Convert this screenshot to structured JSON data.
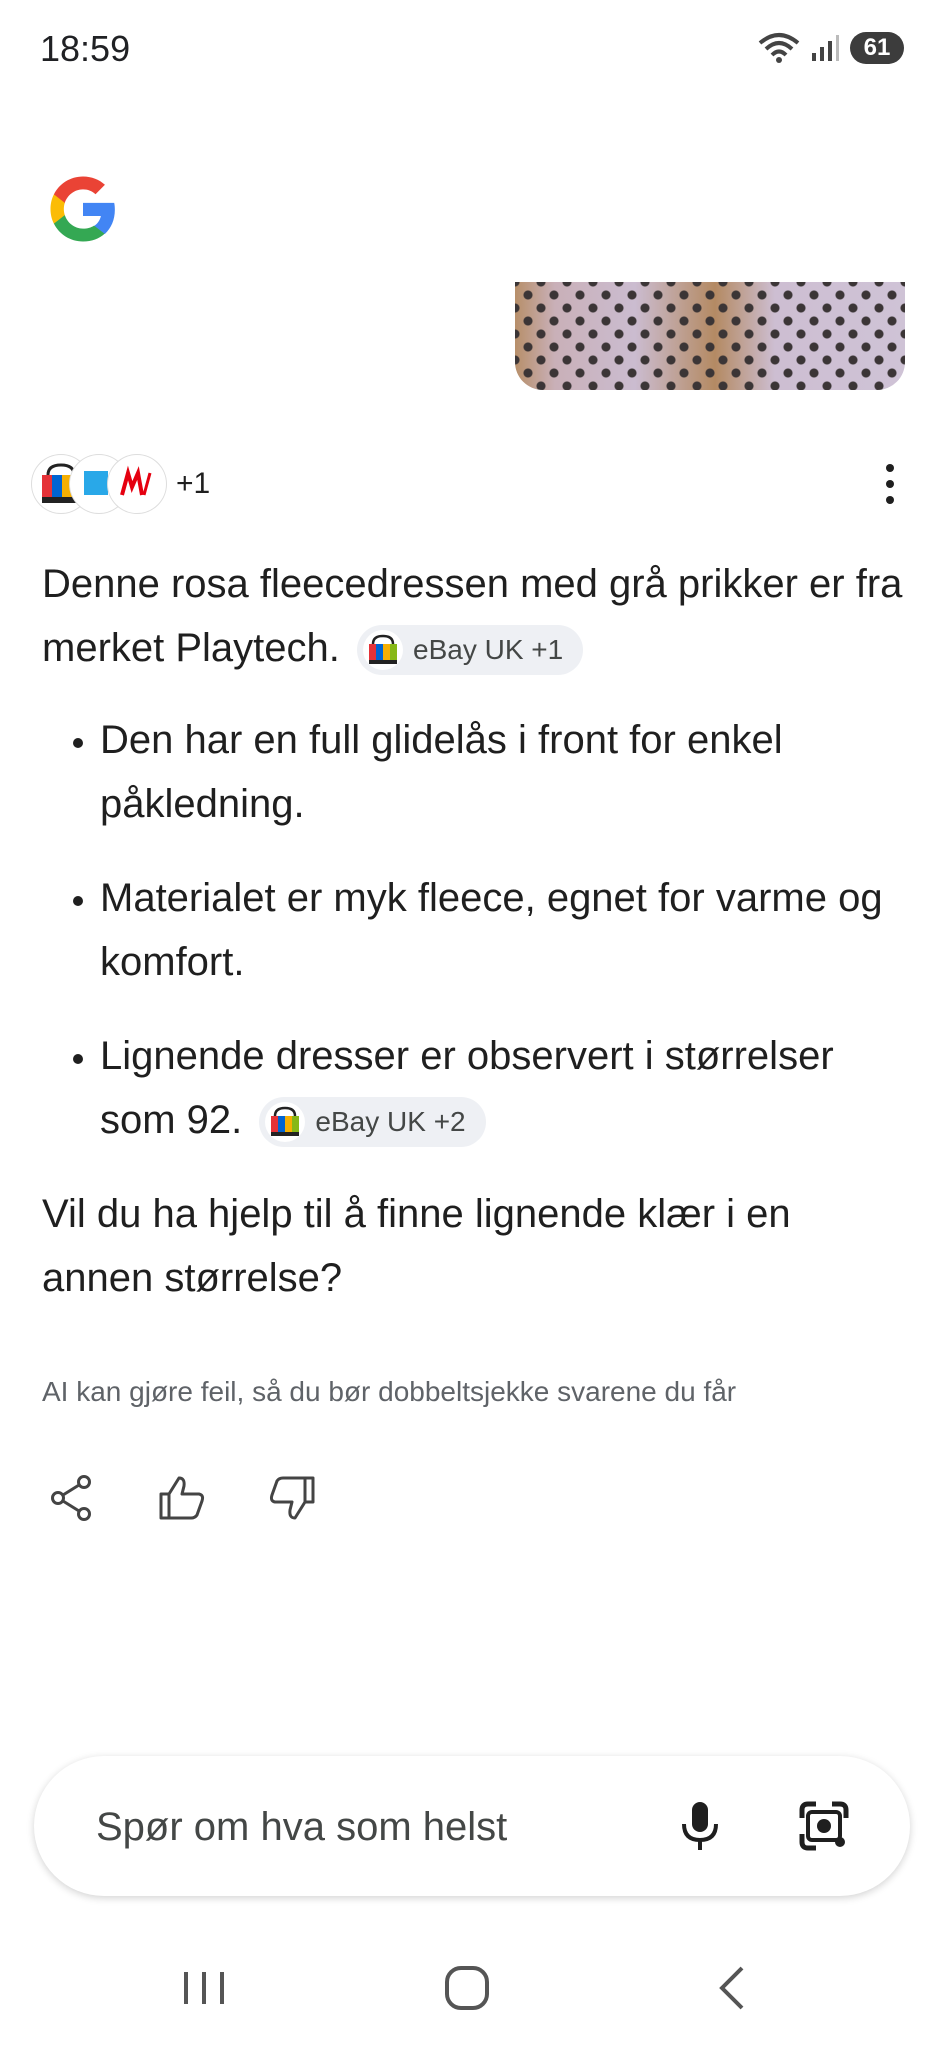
{
  "status": {
    "time": "18:59",
    "battery": "61"
  },
  "sources": {
    "more": "+1"
  },
  "answer": {
    "intro": "Denne rosa fleecedressen med grå prikker er fra merket Playtech.",
    "intro_chip": "eBay UK +1",
    "bullets": [
      {
        "text": "Den har en full glidelås i front for enkel påkledning."
      },
      {
        "text": "Materialet er myk fleece, egnet for varme og komfort."
      },
      {
        "text": "Lignende dresser er observert i størrelser som 92.",
        "chip": "eBay UK +2"
      }
    ],
    "follow_up": "Vil du ha hjelp til å finne lignende klær i en annen størrelse?"
  },
  "disclaimer": "AI kan gjøre feil, så du bør dobbeltsjekke svarene du får",
  "search": {
    "placeholder": "Spør om hva som helst"
  },
  "colors": {
    "accent": "#1a73e8",
    "chip_bg": "#eef0f4",
    "text": "#1f1f1f"
  }
}
